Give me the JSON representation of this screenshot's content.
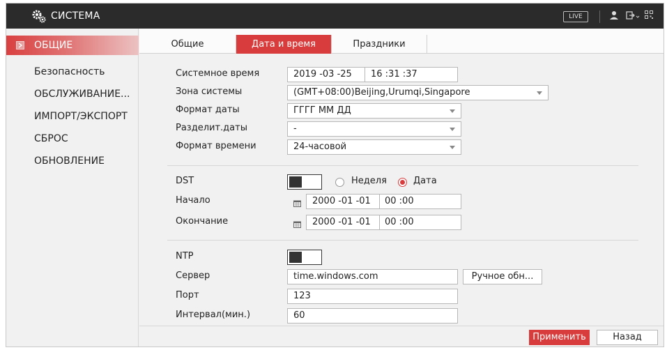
{
  "header": {
    "title": "СИСТЕМА",
    "live_label": "LIVE",
    "logo_icon": "gears-icon",
    "icons": [
      "user-icon",
      "logout-icon",
      "qr-code-icon"
    ]
  },
  "sidebar": {
    "items": [
      {
        "label": "ОБЩИЕ",
        "active": true
      },
      {
        "label": "Безопасность"
      },
      {
        "label": "ОБСЛУЖИВАНИЕ..."
      },
      {
        "label": "ИМПОРТ/ЭКСПОРТ"
      },
      {
        "label": "СБРОС"
      },
      {
        "label": "ОБНОВЛЕНИЕ"
      }
    ]
  },
  "tabs": [
    {
      "label": "Общие"
    },
    {
      "label": "Дата и время",
      "active": true
    },
    {
      "label": "Праздники"
    }
  ],
  "form": {
    "system_time": {
      "label": "Системное время",
      "date": "2019 -03 -25",
      "time": "16 :31 :37"
    },
    "time_zone": {
      "label": "Зона системы",
      "value": "(GMT+08:00)Beijing,Urumqi,Singapore"
    },
    "date_format": {
      "label": "Формат даты",
      "value": "ГГГГ ММ ДД"
    },
    "date_separator": {
      "label": "Разделит.даты",
      "value": "-"
    },
    "time_format": {
      "label": "Формат времени",
      "value": "24-часовой"
    },
    "dst": {
      "label": "DST",
      "enabled": false,
      "option_week": "Неделя",
      "option_date": "Дата",
      "selected": "Дата"
    },
    "start": {
      "label": "Начало",
      "date": "2000 -01 -01",
      "time": "00 :00"
    },
    "end": {
      "label": "Окончание",
      "date": "2000 -01 -01",
      "time": "00 :00"
    },
    "ntp": {
      "label": "NTP",
      "enabled": false
    },
    "server": {
      "label": "Сервер",
      "value": "time.windows.com",
      "update_button": "Ручное обн..."
    },
    "port": {
      "label": "Порт",
      "value": "123"
    },
    "interval": {
      "label": "Интервал(мин.)",
      "value": "60"
    }
  },
  "footer": {
    "apply_label": "Применить",
    "back_label": "Назад"
  },
  "colors": {
    "accent": "#d83c3c",
    "topbar": "#2b2b2b",
    "background": "#f1f1f1"
  }
}
